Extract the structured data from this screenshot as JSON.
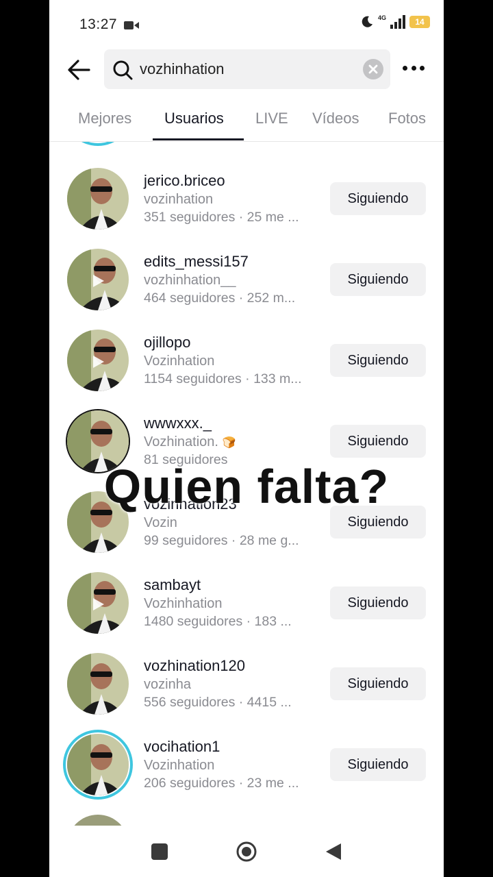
{
  "status_bar": {
    "time": "13:27",
    "network": "4G",
    "battery": "14"
  },
  "search": {
    "value": "vozhinhation"
  },
  "tabs": [
    {
      "label": "Mejores"
    },
    {
      "label": "Usuarios"
    },
    {
      "label": "LIVE"
    },
    {
      "label": "Vídeos"
    },
    {
      "label": "Fotos"
    }
  ],
  "active_tab": "Usuarios",
  "users": [
    {
      "name": "jerico.briceo",
      "nick": "vozinhation",
      "meta": "351 seguidores · 25 me ...",
      "button": "Siguiendo"
    },
    {
      "name": "edits_messi157",
      "nick": "vozhinhation__",
      "meta": "464 seguidores · 252 m...",
      "button": "Siguiendo"
    },
    {
      "name": "ojillopo",
      "nick": "Vozinhation",
      "meta": "1154 seguidores · 133 m...",
      "button": "Siguiendo"
    },
    {
      "name": "wwwxxx._",
      "nick": "Vozhination.",
      "meta": "81 seguidores",
      "button": "Siguiendo"
    },
    {
      "name": "vozinhation23",
      "nick": "Vozin",
      "meta": "99 seguidores · 28 me g...",
      "button": "Siguiendo"
    },
    {
      "name": "sambayt",
      "nick": "Vozhinhation",
      "meta": "1480 seguidores · 183 ...",
      "button": "Siguiendo"
    },
    {
      "name": "vozhination120",
      "nick": "vozinha",
      "meta": "556 seguidores · 4415 ...",
      "button": "Siguiendo"
    },
    {
      "name": "vocihation1",
      "nick": "Vozinhation",
      "meta": "206 seguidores · 23 me ...",
      "button": "Siguiendo"
    }
  ],
  "overlay_text": "Quien falta?",
  "colors": {
    "accent_ring": "#3fc6df",
    "battery": "#f2c34c",
    "secondary_text": "#8a8b91",
    "primary_text": "#161823"
  }
}
